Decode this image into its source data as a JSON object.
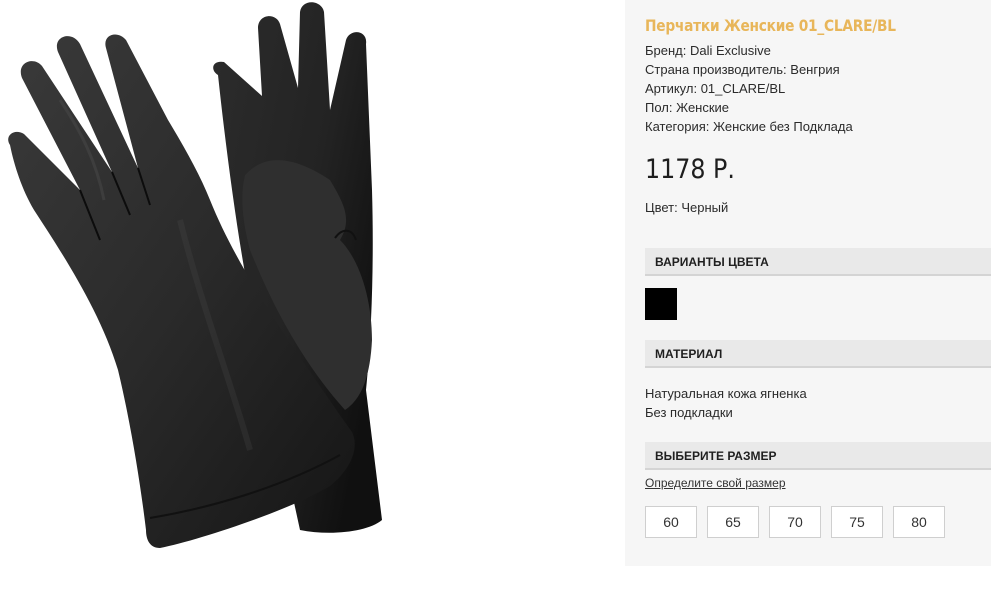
{
  "product": {
    "title": "Перчатки Женские 01_CLARE/BL",
    "brand": "Бренд: Dali Exclusive",
    "country": "Страна производитель: Венгрия",
    "article": "Артикул: 01_CLARE/BL",
    "gender": "Пол: Женские",
    "category": "Категория: Женские без Подклада",
    "price": "1178 Р.",
    "color": "Цвет: Черный",
    "accent_color": "#e8b65a"
  },
  "color_variants": {
    "heading": "ВАРИАНТЫ ЦВЕТА",
    "swatches": [
      "#000000"
    ]
  },
  "material": {
    "heading": "МАТЕРИАЛ",
    "lines": [
      "Натуральная кожа ягненка",
      "Без подкладки"
    ]
  },
  "size": {
    "heading": "ВЫБЕРИТЕ РАЗМЕР",
    "link": "Определите свой размер",
    "options": [
      "60",
      "65",
      "70",
      "75",
      "80"
    ]
  }
}
